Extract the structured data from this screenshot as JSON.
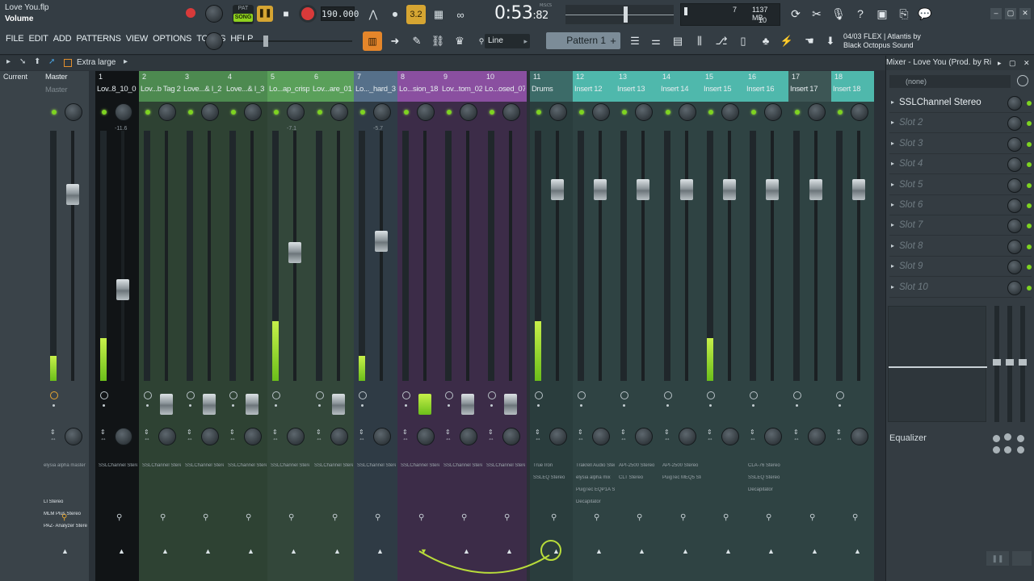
{
  "window": {
    "file_name": "Love You.flp",
    "hint_title": "Volume"
  },
  "menu": [
    "FILE",
    "EDIT",
    "ADD",
    "PATTERNS",
    "VIEW",
    "OPTIONS",
    "TOOLS",
    "HELP"
  ],
  "transport": {
    "pat_label": "PAT",
    "song_label": "SONG",
    "bpm": "190.000",
    "time_main": "0:53",
    "time_sub": ":82",
    "time_unit": "M:S:CS"
  },
  "toolbar": {
    "snap_value": "3.2",
    "line_mode": "Line",
    "pattern_name": "Pattern 1",
    "plus_label": "+"
  },
  "cpu": {
    "polyphony": "7",
    "memory": "1137 MB",
    "voices": "10"
  },
  "hint_bar": {
    "line1": "04/03  FLEX | Atlantis by",
    "line2": "Black Octopus Sound"
  },
  "mixer_bar": {
    "size_label": "Extra large"
  },
  "tracks": [
    {
      "num": "Current",
      "name": "",
      "label": "Master",
      "color": "#3a4349",
      "fx": [
        "elysia alpha master",
        "",
        "",
        "LI Stereo",
        "MLM Plus Stereo",
        "PAZ- Analyzer Stereo"
      ]
    },
    {
      "num": "1",
      "name": "Lov..8_10_0",
      "color": "#111416",
      "db": "-11.6",
      "fx": [
        "SSLChannel Stereo"
      ]
    },
    {
      "num": "2",
      "name": "Lov...b Tag 2",
      "color": "#2e4233",
      "fx": [
        "SSLChannel Stereo"
      ]
    },
    {
      "num": "3",
      "name": "Love...& I_2",
      "color": "#2e4233",
      "fx": [
        "SSLChannel Stereo"
      ]
    },
    {
      "num": "4",
      "name": "Love...& I_3",
      "color": "#2e4233",
      "fx": [
        "SSLChannel Stereo"
      ]
    },
    {
      "num": "5",
      "name": "Lo...ap_crisp",
      "color": "#33473a",
      "db": "-7.1",
      "fx": [
        "SSLChannel Stereo"
      ]
    },
    {
      "num": "6",
      "name": "Lov...are_01",
      "color": "#33473a",
      "fx": [
        "SSLChannel Stereo"
      ]
    },
    {
      "num": "7",
      "name": "Lo..._hard_3",
      "color": "#2f3b45",
      "db": "-5.7",
      "fx": [
        "SSLChannel Stereo"
      ]
    },
    {
      "num": "8",
      "name": "Lo...sion_18",
      "color": "#3c2c48",
      "fx": [
        "SSLChannel Stereo"
      ]
    },
    {
      "num": "9",
      "name": "Lov...tom_02",
      "color": "#3c2c48",
      "fx": [
        "SSLChannel Stereo"
      ]
    },
    {
      "num": "10",
      "name": "Lo...osed_07",
      "color": "#3c2c48",
      "fx": [
        "SSLChannel Stereo"
      ]
    },
    {
      "num": "11",
      "name": "Drums",
      "color": "#2a3d3d",
      "fx": [
        "True Iron",
        "SSLEQ Stereo"
      ]
    },
    {
      "num": "12",
      "name": "Insert 12",
      "color": "#2f4343",
      "fx": [
        "Trakrell Audio Stereo",
        "elysia alpha mix",
        "PuigTec EQP1A Stereo",
        "Decapitator"
      ]
    },
    {
      "num": "13",
      "name": "Insert 13",
      "color": "#2f4343",
      "fx": [
        "API-2500 Stereo",
        "CLT Stereo"
      ]
    },
    {
      "num": "14",
      "name": "Insert 14",
      "color": "#2f4343",
      "fx": [
        "API-2500 Stereo",
        "PuigTec MEQ5 Stereo"
      ]
    },
    {
      "num": "15",
      "name": "Insert 15",
      "color": "#2f4343",
      "fx": []
    },
    {
      "num": "16",
      "name": "Insert 16",
      "color": "#2f4343",
      "fx": [
        "CLA-76 Stereo",
        "SSLEQ Stereo",
        "Decapitator"
      ]
    },
    {
      "num": "17",
      "name": "Insert 17",
      "color": "#2f4343",
      "fx": []
    },
    {
      "num": "18",
      "name": "Insert 18",
      "color": "#2f4343",
      "fx": []
    }
  ],
  "fx_panel": {
    "title": "Mixer - Love You (Prod. by Ri...",
    "input": "(none)",
    "slots": [
      "SSLChannel Stereo",
      "Slot 2",
      "Slot 3",
      "Slot 4",
      "Slot 5",
      "Slot 6",
      "Slot 7",
      "Slot 8",
      "Slot 9",
      "Slot 10"
    ],
    "eq_label": "Equalizer"
  },
  "colors": {
    "meter": "#8fd11e",
    "accent_orange": "#e5862a",
    "insert_teal": "#4fb8ac",
    "green_header": "#5cae5a",
    "purple_header": "#8a4fa0"
  }
}
